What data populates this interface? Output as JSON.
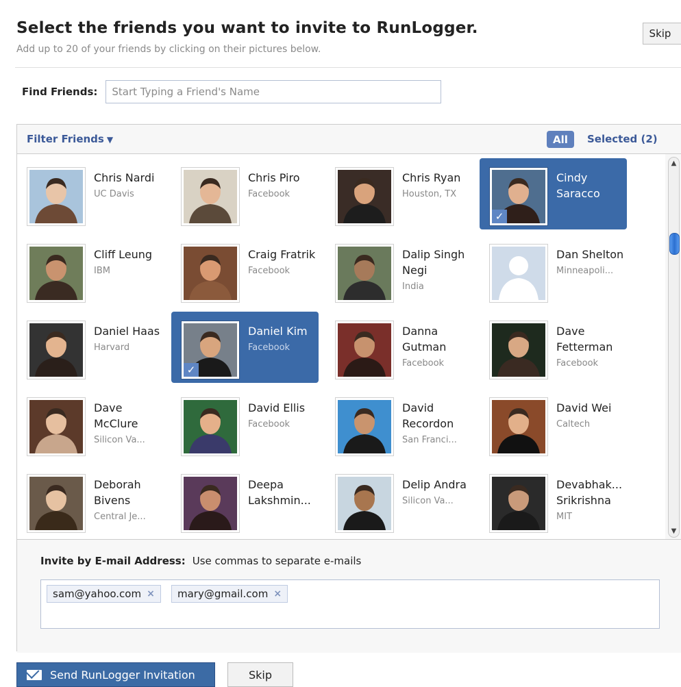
{
  "header": {
    "title": "Select the friends you want to invite to RunLogger.",
    "subtitle": "Add up to 20 of your friends by clicking on their pictures below.",
    "skip_label": "Skip"
  },
  "find": {
    "label": "Find Friends:",
    "placeholder": "Start Typing a Friend's Name"
  },
  "filter": {
    "label": "Filter Friends",
    "all_label": "All",
    "selected_label": "Selected (2)"
  },
  "friends": [
    {
      "name": "Chris Nardi",
      "network": "UC Davis",
      "selected": false
    },
    {
      "name": "Chris Piro",
      "network": "Facebook",
      "selected": false
    },
    {
      "name": "Chris Ryan",
      "network": "Houston, TX",
      "selected": false
    },
    {
      "name": "Cindy Saracco",
      "network": "",
      "selected": true
    },
    {
      "name": "Cliff Leung",
      "network": "IBM",
      "selected": false
    },
    {
      "name": "Craig Fratrik",
      "network": "Facebook",
      "selected": false
    },
    {
      "name": "Dalip Singh Negi",
      "network": "India",
      "selected": false
    },
    {
      "name": "Dan Shelton",
      "network": "Minneapoli...",
      "selected": false
    },
    {
      "name": "Daniel Haas",
      "network": "Harvard",
      "selected": false
    },
    {
      "name": "Daniel Kim",
      "network": "Facebook",
      "selected": true
    },
    {
      "name": "Danna Gutman",
      "network": "Facebook",
      "selected": false
    },
    {
      "name": "Dave Fetterman",
      "network": "Facebook",
      "selected": false
    },
    {
      "name": "Dave McClure",
      "network": "Silicon Va...",
      "selected": false
    },
    {
      "name": "David Ellis",
      "network": "Facebook",
      "selected": false
    },
    {
      "name": "David Recordon",
      "network": "San Franci...",
      "selected": false
    },
    {
      "name": "David Wei",
      "network": "Caltech",
      "selected": false
    },
    {
      "name": "Deborah Bivens",
      "network": "Central Je...",
      "selected": false
    },
    {
      "name": "Deepa Lakshmin...",
      "network": "",
      "selected": false
    },
    {
      "name": "Delip Andra",
      "network": "Silicon Va...",
      "selected": false
    },
    {
      "name": "Devabhak... Srikrishna",
      "network": "MIT",
      "selected": false
    }
  ],
  "email": {
    "label": "Invite by E-mail Address:",
    "hint": "Use commas to separate e-mails",
    "tokens": [
      "sam@yahoo.com",
      "mary@gmail.com"
    ],
    "remove_glyph": "×"
  },
  "footer": {
    "send_label": "Send RunLogger Invitation",
    "skip_label": "Skip"
  },
  "icons": {
    "dropdown": "caret-down-icon",
    "check": "checkmark-icon",
    "envelope": "envelope-icon",
    "remove": "close-icon"
  },
  "colors": {
    "brand_blue": "#3b5998",
    "selected_bg": "#3b6aa8",
    "all_button": "#5f80bd"
  }
}
